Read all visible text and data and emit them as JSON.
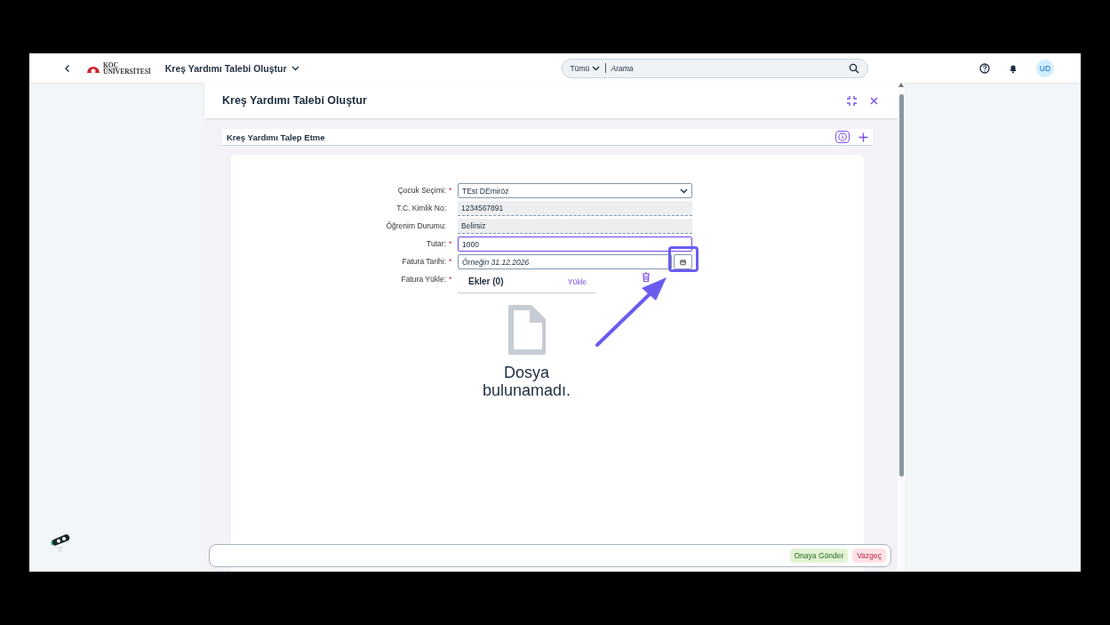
{
  "shell": {
    "logo_lines": [
      "KOÇ",
      "ÜNİVERSİTESİ"
    ],
    "title": "Kreş Yardımı Talebi Oluştur",
    "search": {
      "scope": "Tümü",
      "placeholder": "Arama"
    },
    "avatar": "UD"
  },
  "dialog": {
    "title": "Kreş Yardımı Talebi Oluştur",
    "section": {
      "title": "Kreş Yardımı Talep Etme"
    },
    "fields": [
      {
        "kind": "select",
        "label": "Çocuk Seçimi:",
        "required_mark": "*",
        "value": "TEst DEmiröz",
        "focused": false
      },
      {
        "kind": "readonly",
        "label": "T.C. Kimlik No:",
        "value": "1234567891",
        "focused": false
      },
      {
        "kind": "readonly",
        "label": "Öğrenim Durumu:",
        "value": "Belirsiz",
        "focused": false
      },
      {
        "kind": "input",
        "label": "Tutar:",
        "required_mark": "*",
        "value": "1000",
        "focused": true
      },
      {
        "kind": "date",
        "label": "Fatura Tarihi:",
        "required_mark": "*",
        "placeholder": "Örneğin 31.12.2026",
        "focused": false
      },
      {
        "kind": "upload",
        "label": "Fatura Yükle:",
        "required_mark": "*",
        "attachments_title": "Ekler (0)",
        "upload_link": "Yükle",
        "empty_text": "Dosya bulunamadı."
      }
    ],
    "buttons": [
      {
        "label": "Onaya Gönder",
        "kind": "accept"
      },
      {
        "label": "Vazgeç",
        "kind": "reject"
      }
    ]
  }
}
